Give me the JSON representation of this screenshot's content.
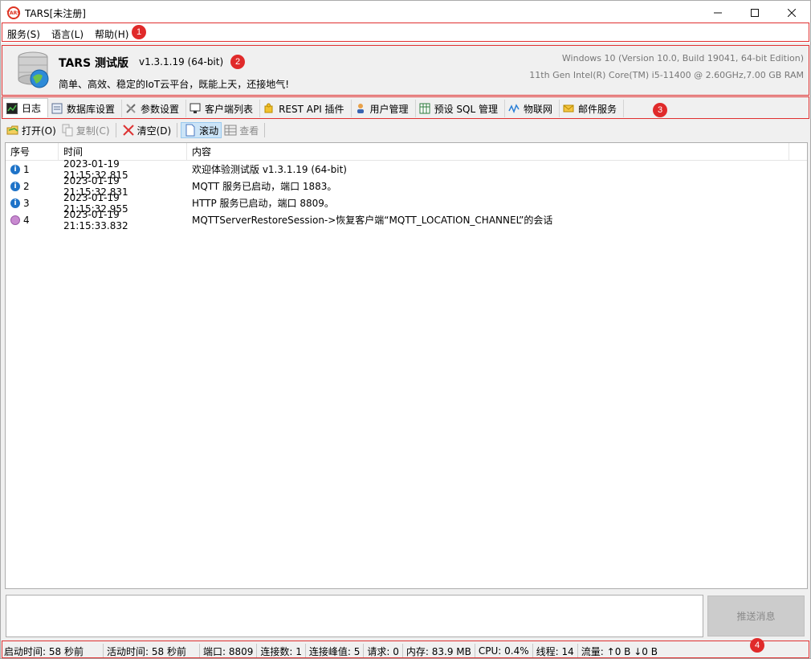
{
  "window": {
    "title": "TARS[未注册]",
    "logo_text": "TARS"
  },
  "menu": [
    "服务(S)",
    "语言(L)",
    "帮助(H)"
  ],
  "header": {
    "product_name": "TARS 测试版",
    "version": "v1.3.1.19 (64-bit)",
    "slogan": "简单、高效、稳定的IoT云平台，既能上天，还接地气!",
    "os_info": "Windows 10 (Version 10.0, Build 19041, 64-bit Edition)",
    "cpu_info": "11th Gen Intel(R) Core(TM) i5-11400 @ 2.60GHz,7.00 GB RAM"
  },
  "tabs": [
    {
      "label": "日志",
      "icon": "log-icon"
    },
    {
      "label": "数据库设置",
      "icon": "database-settings-icon"
    },
    {
      "label": "参数设置",
      "icon": "tools-icon"
    },
    {
      "label": "客户端列表",
      "icon": "monitor-icon"
    },
    {
      "label": "REST API 插件",
      "icon": "puzzle-icon"
    },
    {
      "label": "用户管理",
      "icon": "user-icon"
    },
    {
      "label": "预设 SQL 管理",
      "icon": "table-icon"
    },
    {
      "label": "物联网",
      "icon": "iot-icon"
    },
    {
      "label": "邮件服务",
      "icon": "mail-icon"
    }
  ],
  "toolbar": {
    "open": "打开(O)",
    "copy": "复制(C)",
    "clear": "清空(D)",
    "scroll": "滚动",
    "view": "查看"
  },
  "log": {
    "columns": [
      "序号",
      "时间",
      "内容"
    ],
    "rows": [
      {
        "no": "1",
        "time": "2023-01-19 21:15:32.815",
        "content": "欢迎体验测试版 v1.3.1.19 (64-bit)",
        "kind": "info"
      },
      {
        "no": "2",
        "time": "2023-01-19 21:15:32.831",
        "content": "MQTT 服务已启动，端口 1883。",
        "kind": "info"
      },
      {
        "no": "3",
        "time": "2023-01-19 21:15:32.955",
        "content": "HTTP 服务已启动，端口 8809。",
        "kind": "info"
      },
      {
        "no": "4",
        "time": "2023-01-19 21:15:33.832",
        "content": "MQTTServerRestoreSession->恢复客户端“MQTT_LOCATION_CHANNEL”的会话",
        "kind": "session"
      }
    ]
  },
  "send_button": "推送消息",
  "status": [
    "启动时间: 58 秒前",
    "活动时间: 58 秒前",
    "端口: 8809",
    "连接数: 1",
    "连接峰值: 5",
    "请求: 0",
    "内存: 83.9 MB",
    "CPU: 0.4%",
    "线程: 14",
    "流量: ↑0 B  ↓0 B"
  ],
  "annotations": [
    "1",
    "2",
    "3",
    "4"
  ],
  "colors": {
    "highlight": "#e03030",
    "info_icon": "#1e73c8",
    "session_icon": "#c88ad0"
  }
}
